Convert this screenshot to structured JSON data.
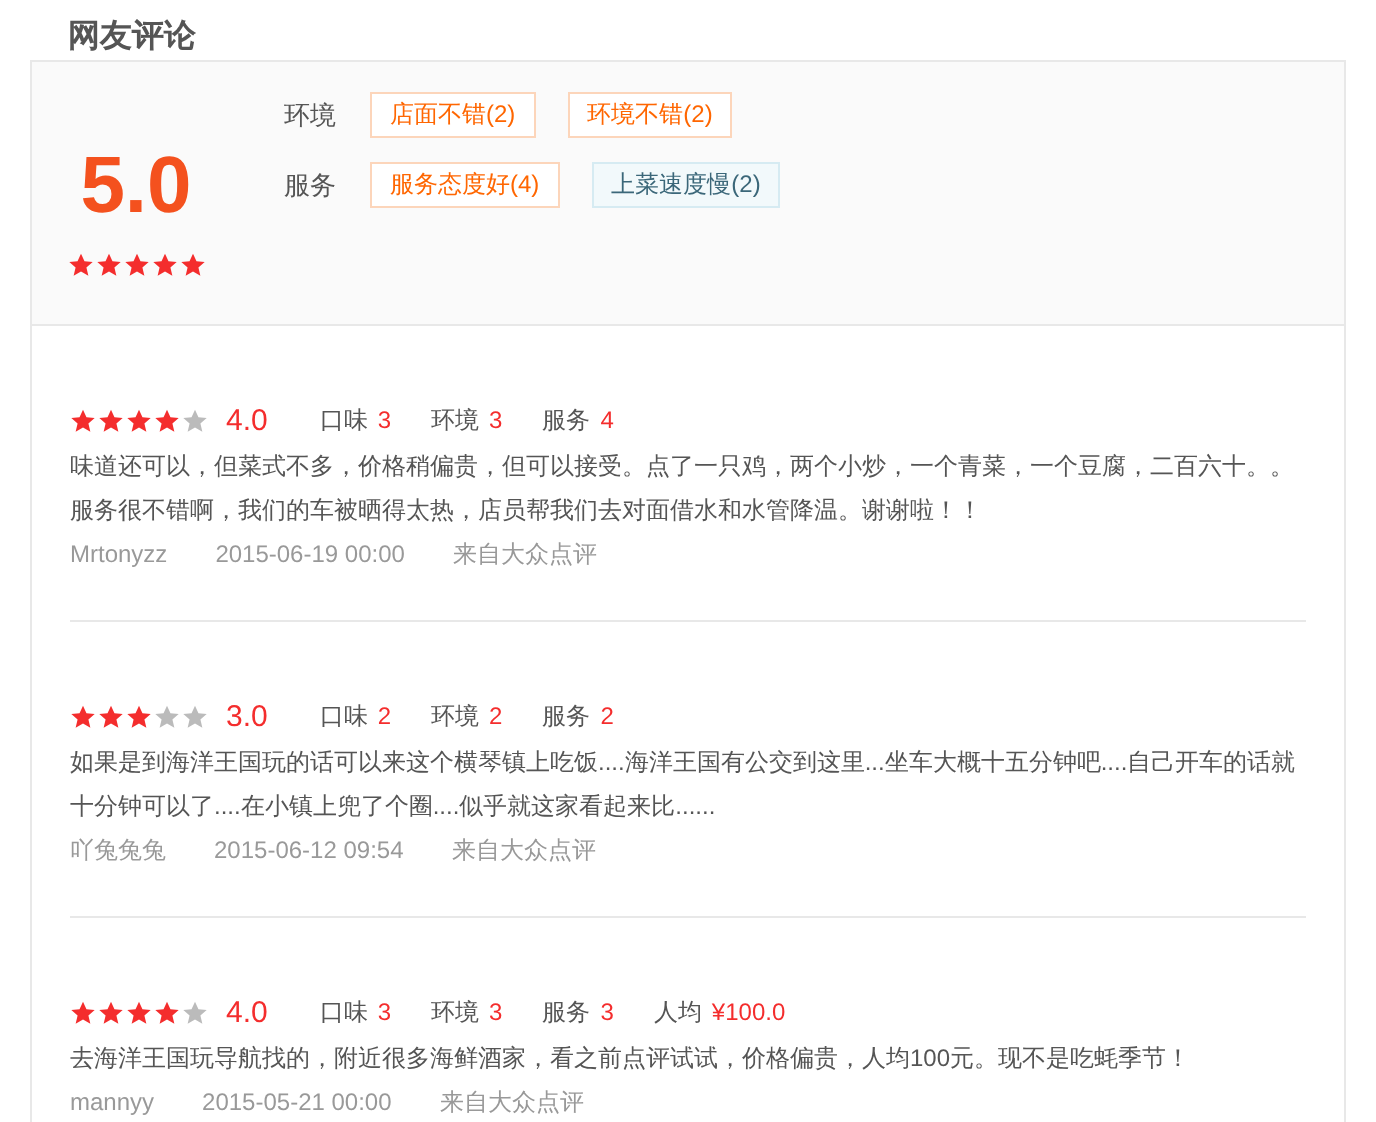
{
  "title": "网友评论",
  "summary": {
    "score": "5.0",
    "stars": 5,
    "groups": [
      {
        "label": "环境",
        "tags": [
          {
            "text": "店面不错(2)",
            "kind": "positive"
          },
          {
            "text": "环境不错(2)",
            "kind": "positive"
          }
        ]
      },
      {
        "label": "服务",
        "tags": [
          {
            "text": "服务态度好(4)",
            "kind": "positive"
          },
          {
            "text": "上菜速度慢(2)",
            "kind": "negative"
          }
        ]
      }
    ]
  },
  "reviews": [
    {
      "stars": 4,
      "score": "4.0",
      "ratings": [
        {
          "label": "口味",
          "value": "3"
        },
        {
          "label": "环境",
          "value": "3"
        },
        {
          "label": "服务",
          "value": "4"
        }
      ],
      "text": "味道还可以，但菜式不多，价格稍偏贵，但可以接受。点了一只鸡，两个小炒，一个青菜，一个豆腐，二百六十。。服务很不错啊，我们的车被晒得太热，店员帮我们去对面借水和水管降温。谢谢啦！！",
      "author": "Mrtonyzz",
      "date": "2015-06-19 00:00",
      "source": "来自大众点评"
    },
    {
      "stars": 3,
      "score": "3.0",
      "ratings": [
        {
          "label": "口味",
          "value": "2"
        },
        {
          "label": "环境",
          "value": "2"
        },
        {
          "label": "服务",
          "value": "2"
        }
      ],
      "text": "如果是到海洋王国玩的话可以来这个横琴镇上吃饭....海洋王国有公交到这里...坐车大概十五分钟吧....自己开车的话就十分钟可以了....在小镇上兜了个圈....似乎就这家看起来比......",
      "author": "吖兔兔兔",
      "date": "2015-06-12 09:54",
      "source": "来自大众点评"
    },
    {
      "stars": 4,
      "score": "4.0",
      "ratings": [
        {
          "label": "口味",
          "value": "3"
        },
        {
          "label": "环境",
          "value": "3"
        },
        {
          "label": "服务",
          "value": "3"
        },
        {
          "label": "人均",
          "value": "¥100.0"
        }
      ],
      "text": "去海洋王国玩导航找的，附近很多海鲜酒家，看之前点评试试，价格偏贵，人均100元。现不是吃蚝季节！",
      "author": "mannyy",
      "date": "2015-05-21 00:00",
      "source": "来自大众点评"
    }
  ]
}
